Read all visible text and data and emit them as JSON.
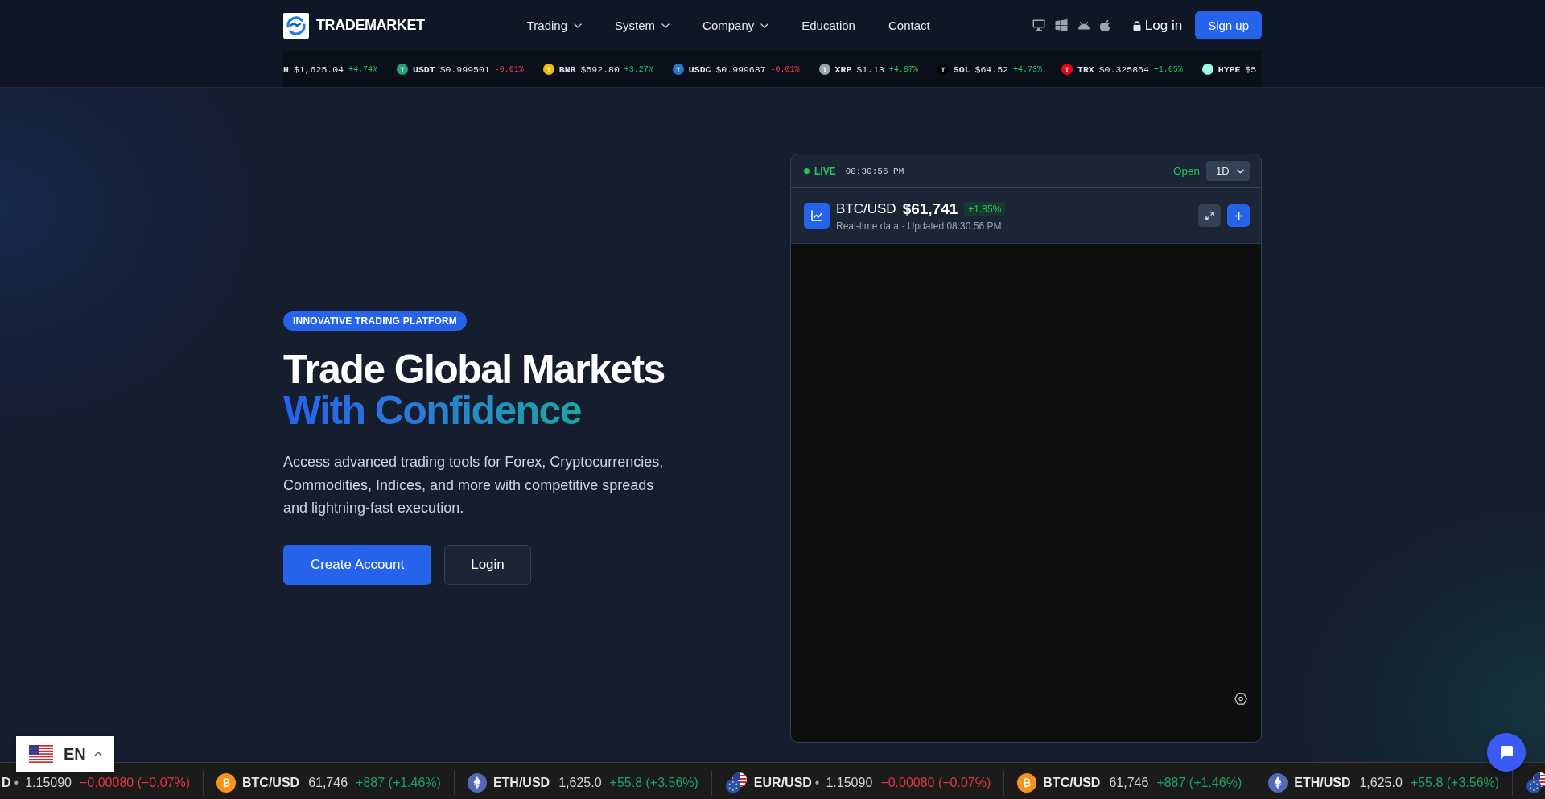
{
  "header": {
    "logo": "TRADEMARKET",
    "nav": [
      {
        "label": "Trading",
        "dropdown": true
      },
      {
        "label": "System",
        "dropdown": true
      },
      {
        "label": "Company",
        "dropdown": true
      },
      {
        "label": "Education",
        "dropdown": false
      },
      {
        "label": "Contact",
        "dropdown": false
      }
    ],
    "login": "Log in",
    "signup": "Sign up"
  },
  "price_ticker": [
    {
      "symbol": "H",
      "price": "$1,625.04",
      "change": "+4.74%",
      "rising": true
    },
    {
      "symbol": "USDT",
      "price": "$0.999501",
      "change": "-0.01%",
      "rising": false,
      "color": "#26a17b"
    },
    {
      "symbol": "BNB",
      "price": "$592.80",
      "change": "+3.27%",
      "rising": true,
      "color": "#f0b90b"
    },
    {
      "symbol": "USDC",
      "price": "$0.999687",
      "change": "-0.01%",
      "rising": false,
      "color": "#2775ca"
    },
    {
      "symbol": "XRP",
      "price": "$1.13",
      "change": "+4.87%",
      "rising": true,
      "color": "#9ca3af"
    },
    {
      "symbol": "SOL",
      "price": "$64.52",
      "change": "+4.73%",
      "rising": true,
      "color": "#000000"
    },
    {
      "symbol": "TRX",
      "price": "$0.325864",
      "change": "+1.05%",
      "rising": true,
      "color": "#e50915"
    },
    {
      "symbol": "HYPE",
      "price": "$5",
      "color": "#97fce4"
    }
  ],
  "hero": {
    "badge": "INNOVATIVE TRADING PLATFORM",
    "title": "Trade Global Markets",
    "title_accent": "With Confidence",
    "description": "Access advanced trading tools for Forex, Cryptocurrencies, Commodities, Indices, and more with competitive spreads and lightning-fast execution.",
    "buttons": [
      {
        "label": "Create Account",
        "kind": "primary"
      },
      {
        "label": "Login",
        "kind": "secondary"
      }
    ]
  },
  "chart_widget": {
    "live": "LIVE",
    "time": "08:30:56 PM",
    "market_status": "Open",
    "interval": "1D",
    "symbol": "BTC/USD",
    "price": "$61,741",
    "change": "+1.85%",
    "subtitle": "Real-time data · Updated 08:30:56 PM"
  },
  "market_ticker": [
    {
      "symbol": "D",
      "dot": "•",
      "price": "1.15090",
      "change": "−0.00080 (−0.07%)",
      "rising": false
    },
    {
      "kind": "bitcoin",
      "symbol": "BTC/USD",
      "price": "61,746",
      "change": "+887 (+1.46%)",
      "rising": true
    },
    {
      "kind": "ether",
      "symbol": "ETH/USD",
      "price": "1,625.0",
      "change": "+55.8 (+3.56%)",
      "rising": true
    },
    {
      "kind": "forex",
      "symbol": "EUR/USD",
      "dot": "•",
      "price": "1.15090",
      "change": "−0.00080 (−0.07%)",
      "rising": false
    },
    {
      "kind": "bitcoin",
      "symbol": "BTC/USD",
      "price": "61,746",
      "change": "+887 (+1.46%)",
      "rising": true
    },
    {
      "kind": "ether",
      "symbol": "ETH/USD",
      "price": "1,625.0",
      "change": "+55.8 (+3.56%)",
      "rising": true
    },
    {
      "kind": "forex"
    }
  ],
  "language": {
    "code": "EN"
  }
}
